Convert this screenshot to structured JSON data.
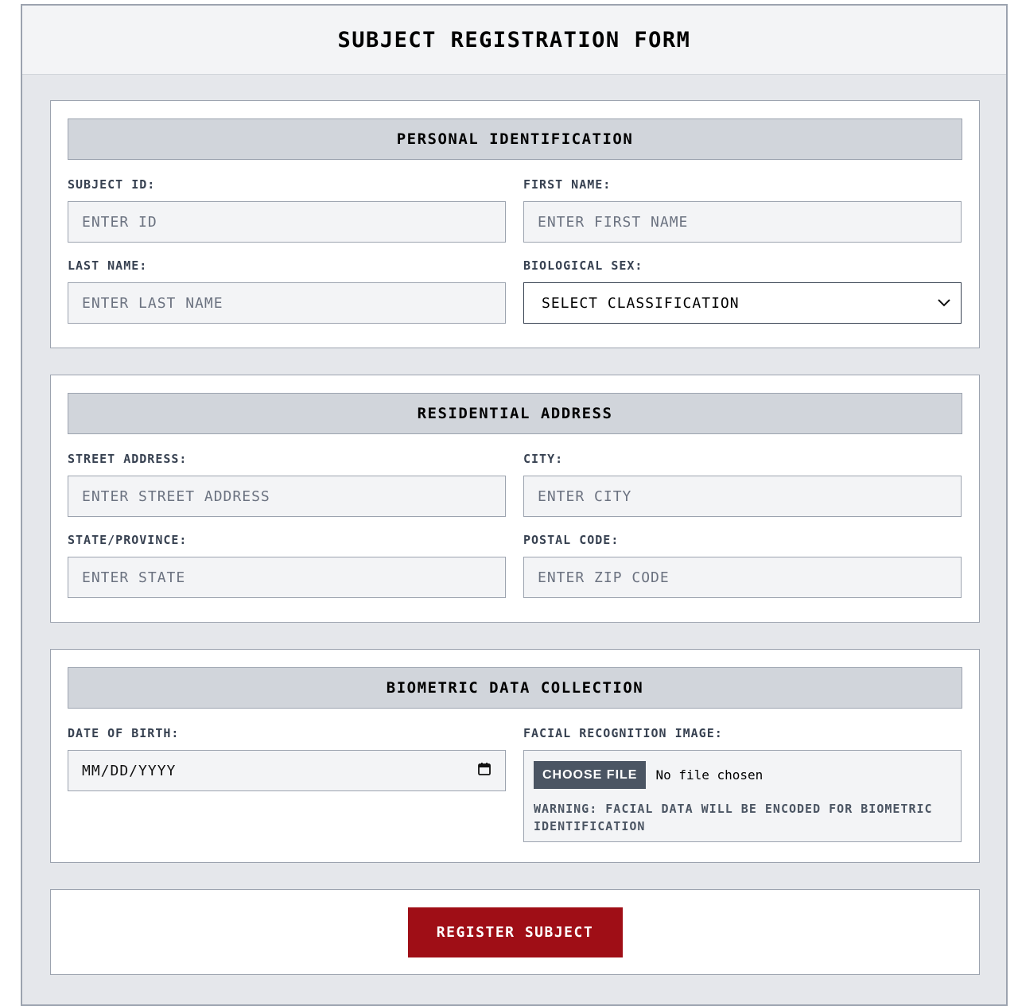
{
  "form": {
    "title": "SUBJECT REGISTRATION FORM",
    "submit_label": "REGISTER SUBJECT"
  },
  "personal": {
    "title": "PERSONAL IDENTIFICATION",
    "subject_id": {
      "label": "SUBJECT ID:",
      "placeholder": "ENTER ID"
    },
    "first_name": {
      "label": "FIRST NAME:",
      "placeholder": "ENTER FIRST NAME"
    },
    "last_name": {
      "label": "LAST NAME:",
      "placeholder": "ENTER LAST NAME"
    },
    "sex": {
      "label": "BIOLOGICAL SEX:",
      "selected": "SELECT CLASSIFICATION"
    }
  },
  "address": {
    "title": "RESIDENTIAL ADDRESS",
    "street": {
      "label": "STREET ADDRESS:",
      "placeholder": "ENTER STREET ADDRESS"
    },
    "city": {
      "label": "CITY:",
      "placeholder": "ENTER CITY"
    },
    "state": {
      "label": "STATE/PROVINCE:",
      "placeholder": "ENTER STATE"
    },
    "postal": {
      "label": "POSTAL CODE:",
      "placeholder": "ENTER ZIP CODE"
    }
  },
  "biometric": {
    "title": "BIOMETRIC DATA COLLECTION",
    "dob": {
      "label": "DATE OF BIRTH:",
      "placeholder": "MM/DD/YYYY"
    },
    "face": {
      "label": "FACIAL RECOGNITION IMAGE:",
      "button": "CHOOSE FILE",
      "status": "No file chosen",
      "warning": "WARNING: FACIAL DATA WILL BE ENCODED FOR BIOMETRIC IDENTIFICATION"
    }
  },
  "colors": {
    "submit": "#9f0e16",
    "section_header": "#d1d5db",
    "background": "#e5e7eb"
  }
}
